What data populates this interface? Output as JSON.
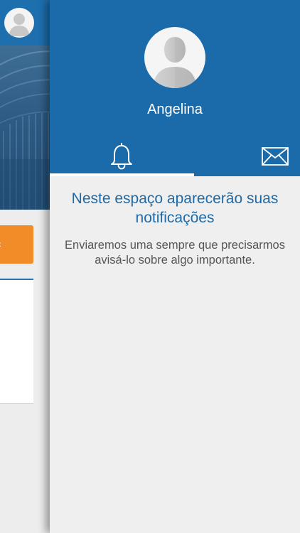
{
  "profile": {
    "name": "Angelina",
    "avatar_icon": "user-avatar-icon"
  },
  "tabs": [
    {
      "id": "notifications",
      "icon": "bell-icon",
      "active": true
    },
    {
      "id": "messages",
      "icon": "mail-icon",
      "active": false
    }
  ],
  "empty_state": {
    "title": "Neste espaço aparecerão suas notificações",
    "description": "Enviaremos uma sempre que precisarmos avisá-lo sobre algo importante."
  },
  "colors": {
    "header_blue": "#1b6aa9",
    "title_blue": "#1f6aa6",
    "accent_orange": "#f28c28",
    "panel_background": "#efefef"
  }
}
